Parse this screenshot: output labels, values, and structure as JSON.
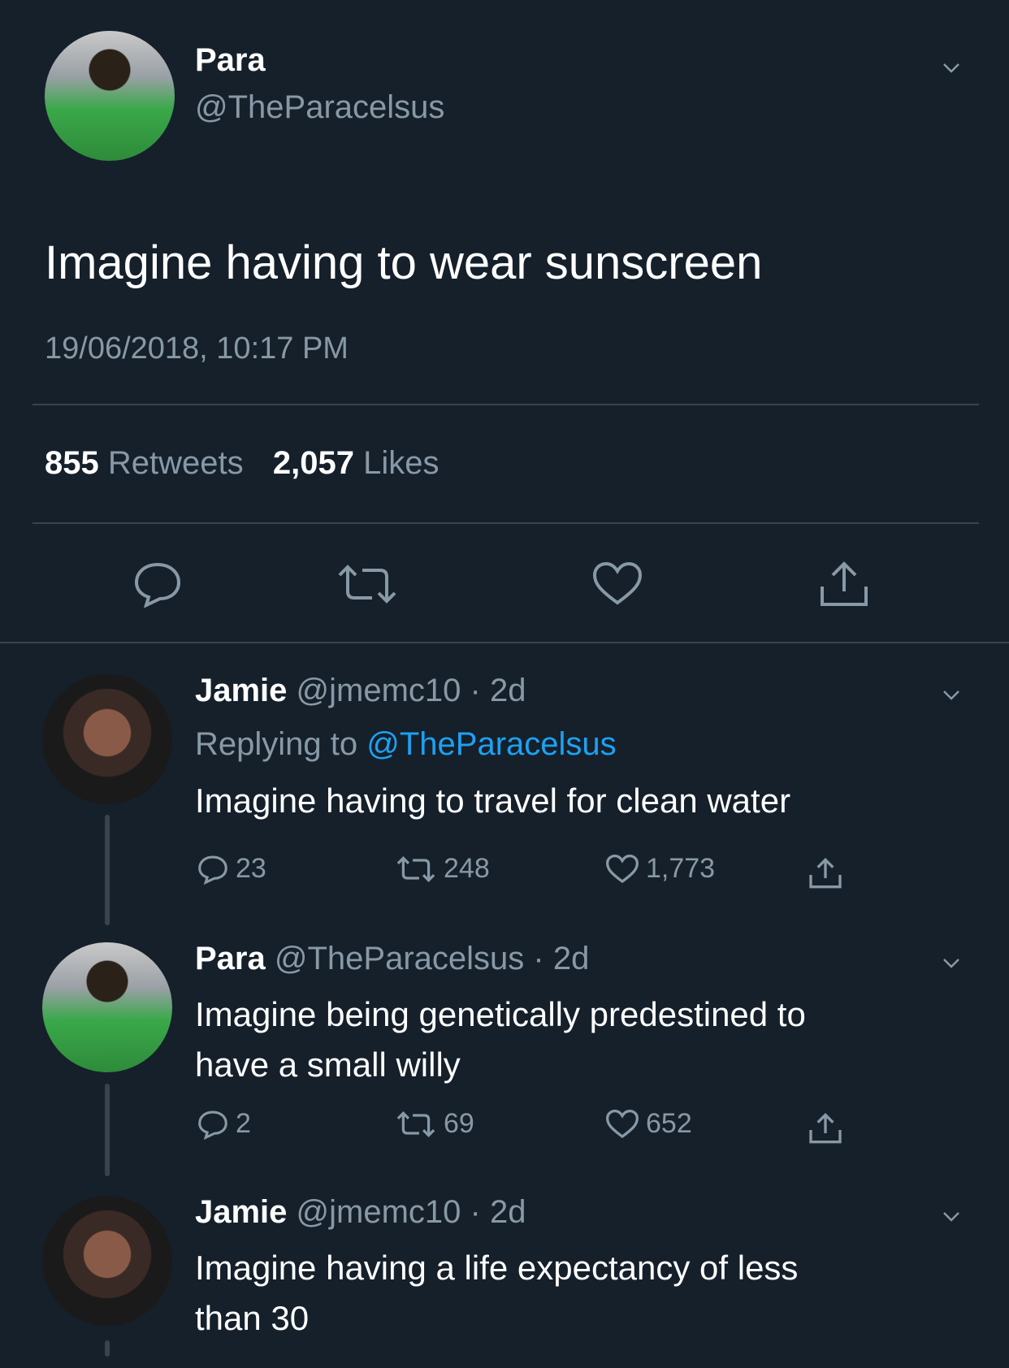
{
  "main_tweet": {
    "name": "Para",
    "handle": "@TheParacelsus",
    "text": "Imagine having to wear sunscreen",
    "timestamp": "19/06/2018, 10:17 PM",
    "retweets_count": "855",
    "retweets_label": "Retweets",
    "likes_count": "2,057",
    "likes_label": "Likes"
  },
  "replies": [
    {
      "name": "Jamie",
      "meta": "@jmemc10 · 2d",
      "replying_prefix": "Replying to",
      "replying_handle": "@TheParacelsus",
      "text": "Imagine having to travel for clean water",
      "reply_count": "23",
      "retweet_count": "248",
      "like_count": "1,773"
    },
    {
      "name": "Para",
      "meta": "@TheParacelsus · 2d",
      "text_line1": "Imagine being genetically predestined to",
      "text_line2": "have a small willy",
      "reply_count": "2",
      "retweet_count": "69",
      "like_count": "652"
    },
    {
      "name": "Jamie",
      "meta": "@jmemc10 · 2d",
      "text_line1": "Imagine having a life expectancy of less",
      "text_line2": "than 30"
    }
  ],
  "colors": {
    "background": "#15202b",
    "muted": "#8899a6",
    "link": "#1da1f2",
    "divider": "#38444d"
  }
}
